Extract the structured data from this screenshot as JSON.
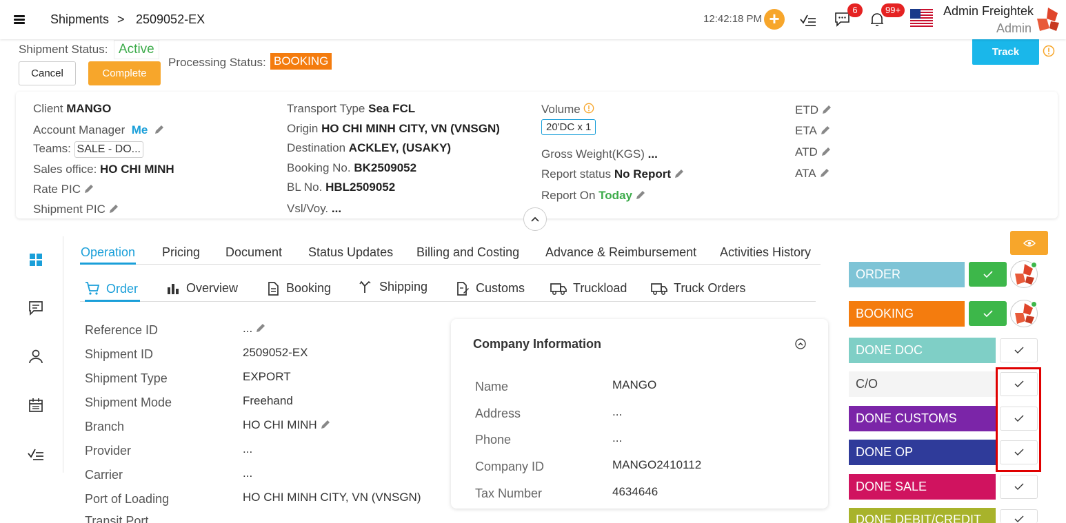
{
  "topbar": {
    "breadcrumb_root": "Shipments",
    "breadcrumb_sep": ">",
    "breadcrumb_current": "2509052-EX",
    "time": "12:42:18 PM",
    "chat_badge": "6",
    "notif_badge": "99+",
    "user_name": "Admin Freightek",
    "user_role": "Admin"
  },
  "status": {
    "shipment_status_label": "Shipment Status:",
    "shipment_status_value": "Active",
    "processing_status_label": "Processing Status:",
    "processing_status_value": "BOOKING",
    "cancel_label": "Cancel",
    "complete_label": "Complete",
    "track_label": "Track"
  },
  "info": {
    "col1": {
      "client_label": "Client",
      "client_value": "MANGO",
      "account_manager_label": "Account Manager",
      "account_manager_value": "Me",
      "teams_label": "Teams:",
      "teams_value": "SALE - DO...",
      "sales_office_label": "Sales office:",
      "sales_office_value": "HO CHI MINH",
      "rate_pic_label": "Rate PIC",
      "shipment_pic_label": "Shipment PIC"
    },
    "col2": {
      "transport_type_label": "Transport Type",
      "transport_type_value": "Sea FCL",
      "origin_label": "Origin",
      "origin_value": "HO CHI MINH CITY, VN (VNSGN)",
      "destination_label": "Destination",
      "destination_value": "ACKLEY, (USAKY)",
      "booking_no_label": "Booking No.",
      "booking_no_value": "BK2509052",
      "bl_no_label": "BL No.",
      "bl_no_value": "HBL2509052",
      "vsl_label": "Vsl/Voy.",
      "vsl_value": "..."
    },
    "col3": {
      "volume_label": "Volume",
      "volume_value": "20'DC x 1",
      "gross_weight_label": "Gross Weight(KGS)",
      "gross_weight_value": "...",
      "report_status_label": "Report status",
      "report_status_value": "No Report",
      "report_on_label": "Report On",
      "report_on_value": "Today"
    },
    "col4": {
      "etd": "ETD",
      "eta": "ETA",
      "atd": "ATD",
      "ata": "ATA"
    }
  },
  "tabs": [
    "Operation",
    "Pricing",
    "Document",
    "Status Updates",
    "Billing and Costing",
    "Advance & Reimbursement",
    "Activities History"
  ],
  "subtabs": [
    "Order",
    "Overview",
    "Booking",
    "Shipping",
    "Customs",
    "Truckload",
    "Truck Orders"
  ],
  "order_fields": [
    {
      "label": "Reference ID",
      "value": "..."
    },
    {
      "label": "Shipment ID",
      "value": "2509052-EX"
    },
    {
      "label": "Shipment Type",
      "value": "EXPORT"
    },
    {
      "label": "Shipment Mode",
      "value": "Freehand"
    },
    {
      "label": "Branch",
      "value": "HO CHI MINH"
    },
    {
      "label": "Provider",
      "value": "..."
    },
    {
      "label": "Carrier",
      "value": "..."
    },
    {
      "label": "Port of Loading",
      "value": "HO CHI MINH CITY, VN (VNSGN)"
    },
    {
      "label": "Transit Port",
      "value": ""
    }
  ],
  "company": {
    "title": "Company Information",
    "fields": [
      {
        "label": "Name",
        "value": "MANGO"
      },
      {
        "label": "Address",
        "value": "..."
      },
      {
        "label": "Phone",
        "value": "..."
      },
      {
        "label": "Company ID",
        "value": "MANGO2410112"
      },
      {
        "label": "Tax Number",
        "value": "4634646"
      }
    ]
  },
  "stages": [
    {
      "label": "ORDER",
      "color": "#7ec4d6"
    },
    {
      "label": "BOOKING",
      "color": "#f47c0e"
    },
    {
      "label": "DONE DOC",
      "color": "#7fcfc6"
    },
    {
      "label": "C/O",
      "color": "#f4f4f4"
    },
    {
      "label": "DONE CUSTOMS",
      "color": "#7b25a8"
    },
    {
      "label": "DONE OP",
      "color": "#2f3b9a"
    },
    {
      "label": "DONE SALE",
      "color": "#d0135f"
    },
    {
      "label": "DONE DEBIT/CREDIT",
      "color": "#a8b32b"
    }
  ],
  "colors": {
    "accent_blue": "#1a9fd9",
    "track_blue": "#1ab7ea",
    "orange": "#f7a62b",
    "green": "#3cab4a",
    "highlight_red": "#e00000"
  }
}
